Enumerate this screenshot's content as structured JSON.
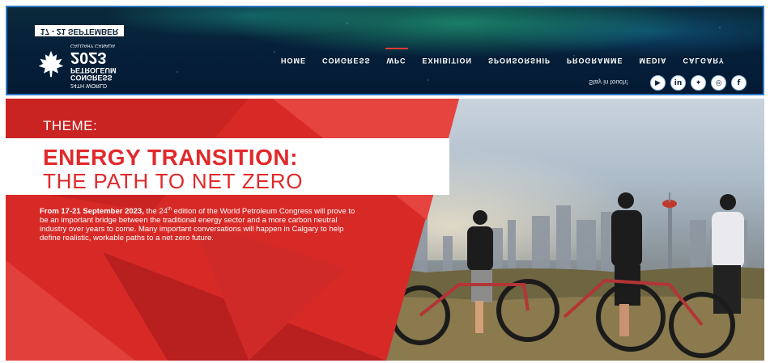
{
  "header": {
    "logo": {
      "dates": "17 - 21 SEPTEMBER",
      "small_text": "CALGARY CANADA",
      "year": "2023",
      "line1": "CONGRESS",
      "line2": "PETROLEUM",
      "line3": "24TH WORLD"
    },
    "nav": [
      {
        "label": "HOME"
      },
      {
        "label": "CONGRESS"
      },
      {
        "label": "WPC"
      },
      {
        "label": "EXHIBITION"
      },
      {
        "label": "SPONSORSHIP"
      },
      {
        "label": "PROGRAMME"
      },
      {
        "label": "MEDIA"
      },
      {
        "label": "CALGARY"
      }
    ],
    "active_nav": "WPC",
    "stay_in_touch": "Stay in touch!",
    "socials": [
      {
        "icon": "youtube-icon",
        "glyph": "▶"
      },
      {
        "icon": "linkedin-icon",
        "glyph": "in"
      },
      {
        "icon": "twitter-icon",
        "glyph": "✦"
      },
      {
        "icon": "instagram-icon",
        "glyph": "◎"
      },
      {
        "icon": "facebook-icon",
        "glyph": "f"
      }
    ]
  },
  "hero": {
    "theme_label": "THEME:",
    "title_line1": "ENERGY TRANSITION:",
    "title_line2": "THE PATH TO NET ZERO",
    "intro_lead": "From 17-21 September 2023,",
    "intro_pre_sup": " the 24",
    "intro_sup": "th",
    "intro_rest": " edition of the World Petroleum Congress will prove to be an important bridge between the traditional energy sector and a more carbon neutral industry over years to come. Many important conversations will happen in Calgary to help define realistic, workable paths to a net zero future."
  },
  "colors": {
    "accent_red": "#e1292b",
    "header_border": "#2f78c4",
    "header_bg": "#06203a"
  }
}
